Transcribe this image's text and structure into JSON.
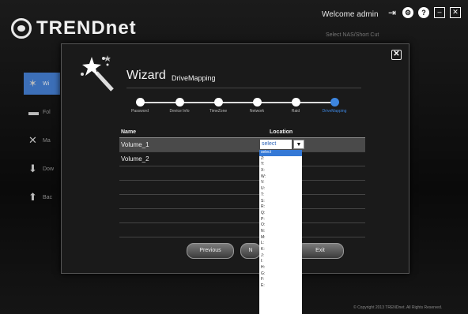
{
  "header": {
    "brand": "TRENDnet",
    "welcome": "Welcome admin",
    "shortcut": "Select NAS/Short Cut",
    "icons": [
      "logout-icon",
      "settings-icon",
      "help-icon",
      "minimize-icon",
      "close-icon"
    ]
  },
  "sidebar": {
    "items": [
      {
        "icon": "wizard-icon",
        "label": "Wi"
      },
      {
        "icon": "folder-icon",
        "label": "Fol"
      },
      {
        "icon": "tools-icon",
        "label": "Ma"
      },
      {
        "icon": "download-icon",
        "label": "Dow"
      },
      {
        "icon": "backup-icon",
        "label": "Bac"
      }
    ]
  },
  "wizard": {
    "title": "Wizard",
    "subtitle": "DriveMapping",
    "steps": [
      "Password",
      "Device Info",
      "TimeZone",
      "Network",
      "Raid",
      "DriveMapping"
    ],
    "current_step": "DriveMapping"
  },
  "table": {
    "col_name": "Name",
    "col_location": "Location",
    "rows": [
      {
        "name": "Volume_1",
        "selected": true
      },
      {
        "name": "Volume_2",
        "selected": false
      },
      {
        "name": "",
        "selected": false
      },
      {
        "name": "",
        "selected": false
      },
      {
        "name": "",
        "selected": false
      },
      {
        "name": "",
        "selected": false
      },
      {
        "name": "",
        "selected": false
      }
    ]
  },
  "location_select": {
    "value": "select",
    "arrow": "chevron-down-icon"
  },
  "dropdown": {
    "options": [
      "select",
      "Z:",
      "Y:",
      "X:",
      "W:",
      "V:",
      "U:",
      "T:",
      "S:",
      "R:",
      "Q:",
      "P:",
      "O:",
      "N:",
      "M:",
      "L:",
      "K:",
      "J:",
      "I:",
      "H:",
      "G:",
      "F:",
      "E:"
    ],
    "highlighted": "select"
  },
  "buttons": {
    "previous": "Previous",
    "next": "N",
    "exit": "Exit"
  },
  "footer": {
    "copyright": "© Copyright 2013 TRENDnet. All Rights Reserved."
  },
  "colors": {
    "accent": "#3d86e0",
    "highlight": "#3579d6"
  }
}
